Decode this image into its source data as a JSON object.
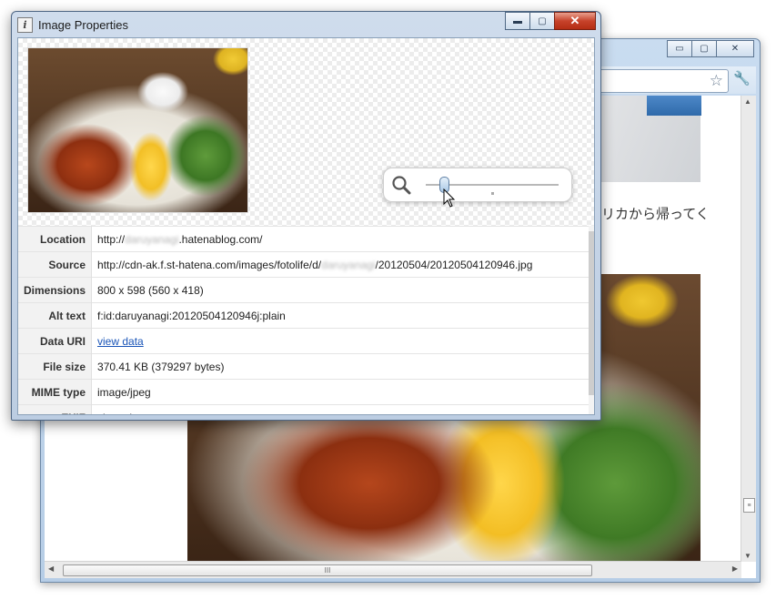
{
  "browser": {
    "window_controls": {
      "minimize": "▭",
      "maximize": "▢",
      "close": "✕"
    },
    "page_text": "リカから帰ってく",
    "vscroll": {
      "up": "▲",
      "down": "▼",
      "grip": "≡"
    },
    "hscroll": {
      "left": "◀",
      "right": "▶",
      "grip": "III"
    },
    "icons": [
      "star-icon",
      "wrench-icon"
    ]
  },
  "dialog": {
    "title": "Image Properties",
    "title_icon_glyph": "i",
    "controls": {
      "minimize": "▬",
      "maximize": "▢",
      "close": "✕"
    },
    "zoom_level": 0.14,
    "properties": [
      {
        "key": "Location",
        "value_prefix": "http://",
        "value_blurred": "daruyanagi",
        "value_suffix": ".hatenablog.com/"
      },
      {
        "key": "Source",
        "value_prefix": "http://cdn-ak.f.st-hatena.com/images/fotolife/d/",
        "value_blurred": "daruyanagi",
        "value_suffix": "/20120504/20120504120946.jpg"
      },
      {
        "key": "Dimensions",
        "value": "800 x 598 (560 x 418)"
      },
      {
        "key": "Alt text",
        "value": "f:id:daruyanagi:20120504120946j:plain"
      },
      {
        "key": "Data URI",
        "link": "view data"
      },
      {
        "key": "File size",
        "value": "370.41 KB (379297 bytes)"
      },
      {
        "key": "MIME type",
        "value": "image/jpeg"
      },
      {
        "key": "EXIF",
        "value": "show data"
      }
    ]
  },
  "colors": {
    "link": "#1a55b8",
    "close_button": "#c7432b",
    "title_bar": "#bccde2"
  }
}
